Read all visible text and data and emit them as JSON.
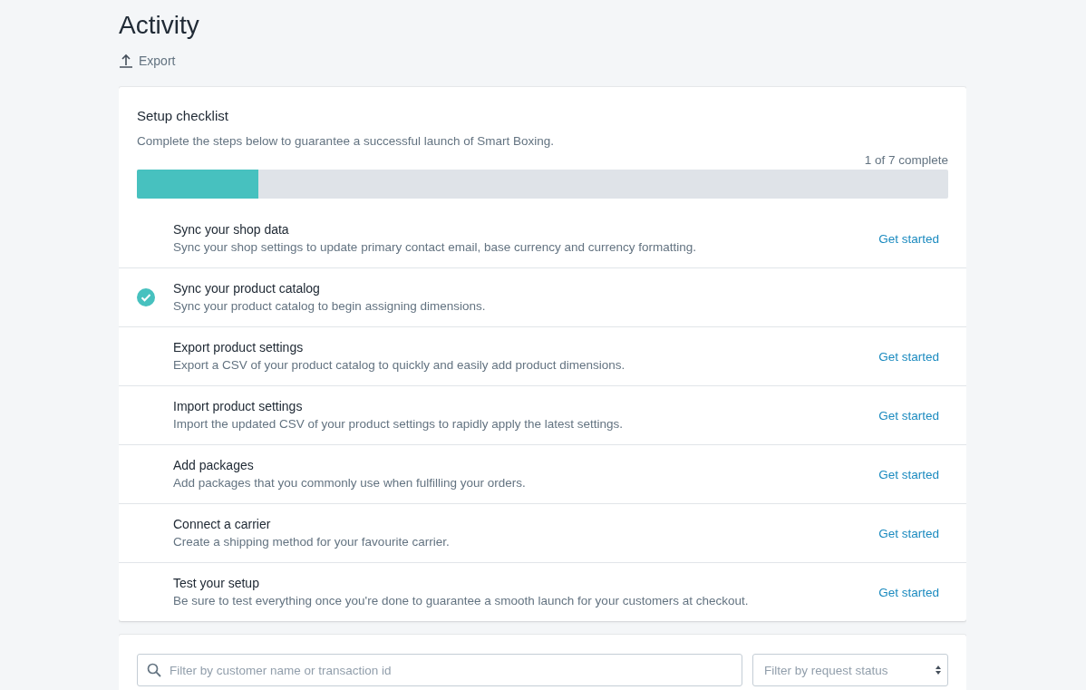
{
  "page": {
    "title": "Activity",
    "export_label": "Export"
  },
  "checklist": {
    "title": "Setup checklist",
    "description": "Complete the steps below to guarantee a successful launch of Smart Boxing.",
    "progress_label": "1 of 7 complete",
    "level": 0.15,
    "steps": [
      {
        "title": "Sync your shop data",
        "description": "Sync your shop settings to update primary contact email, base currency and currency formatting.",
        "done": false,
        "action": "Get started"
      },
      {
        "title": "Sync your product catalog",
        "description": "Sync your product catalog to begin assigning dimensions.",
        "done": true
      },
      {
        "title": "Export product settings",
        "description": "Export a CSV of your product catalog to quickly and easily add product dimensions.",
        "done": false,
        "action": "Get started"
      },
      {
        "title": "Import product settings",
        "description": "Import the updated CSV of your product settings to rapidly apply the latest settings.",
        "done": false,
        "action": "Get started"
      },
      {
        "title": "Add packages",
        "description": "Add packages that you commonly use when fulfilling your orders.",
        "done": false,
        "action": "Get started"
      },
      {
        "title": "Connect a carrier",
        "description": "Create a shipping method for your favourite carrier.",
        "done": false,
        "action": "Get started"
      },
      {
        "title": "Test your setup",
        "description": "Be sure to test everything once you're done to guarantee a smooth launch for your customers at checkout.",
        "done": false,
        "action": "Get started"
      }
    ]
  },
  "filters": {
    "search": {
      "placeholder": "Filter by customer name or transaction id"
    },
    "status": {
      "placeholder": "Filter by request status"
    }
  }
}
